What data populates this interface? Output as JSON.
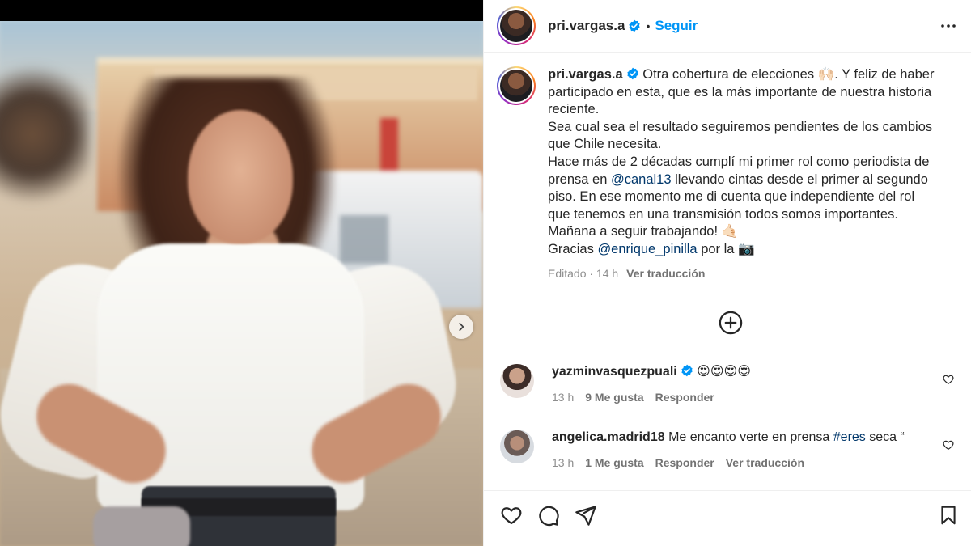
{
  "post": {
    "username": "pri.vargas.a",
    "follow_label": "Seguir",
    "separator": "•"
  },
  "caption": {
    "username": "pri.vargas.a",
    "lines": {
      "l1": "Otra cobertura de elecciones 🙌🏻. Y feliz de haber",
      "l2": "participado en esta, que es la más importante de nuestra historia",
      "l3": "reciente.",
      "l4": "Sea cual sea el resultado seguiremos pendientes de los cambios",
      "l5": "que Chile necesita.",
      "l6": "Hace más de 2 décadas cumplí mi primer rol como periodista de",
      "l7a": "prensa en ",
      "l7_mention": "@canal13",
      "l7b": " llevando cintas desde el primer al segundo",
      "l8": "piso. En ese momento me di cuenta que independiente del rol",
      "l9": "que tenemos en una transmisión todos somos importantes.",
      "l10": "Mañana a seguir trabajando! 🤙🏻",
      "l11a": "Gracias ",
      "l11_mention": "@enrique_pinilla",
      "l11b": " por la 📷"
    },
    "edited": "Editado · 14 h",
    "translate": "Ver traducción"
  },
  "comments": [
    {
      "username": "yazminvasquezpuali",
      "text": "😍😍😍😍",
      "time": "13 h",
      "likes": "9 Me gusta",
      "reply": "Responder"
    },
    {
      "username": "angelica.madrid18",
      "text_a": "Me encanto verte en prensa ",
      "hashtag": "#eres",
      "text_b": " seca “",
      "time": "13 h",
      "likes": "1 Me gusta",
      "reply": "Responder",
      "translate": "Ver traducción"
    }
  ],
  "icons": {
    "more": "more-options-icon",
    "verified": "verified-badge-icon",
    "add": "add-comments-icon",
    "next": "chevron-right-icon",
    "like": "heart-icon",
    "comment": "comment-icon",
    "share": "share-icon",
    "save": "bookmark-icon"
  },
  "colors": {
    "accent": "#0095f6",
    "mention": "#00376b",
    "muted": "#8e8e8e",
    "text": "#262626"
  }
}
